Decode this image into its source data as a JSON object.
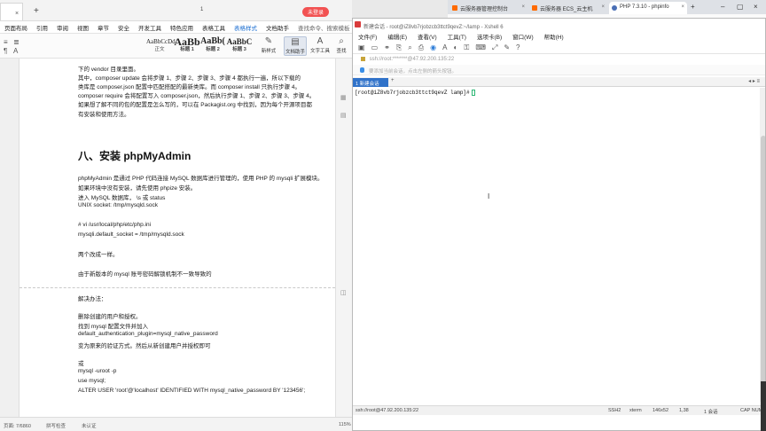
{
  "word": {
    "tab_close": "×",
    "tab_add": "+",
    "page_indicator": "1",
    "login_badge": "未登录",
    "menu": [
      "页面布局",
      "引用",
      "审阅",
      "视图",
      "章节",
      "安全",
      "开发工具",
      "特色应用",
      "表格工具",
      "表格样式",
      "文档助手",
      "查找命令、搜索模板"
    ],
    "menu_active_index": 9,
    "styles": [
      {
        "sample": "AaBbCcDd",
        "name": "正文"
      },
      {
        "sample": "AaBb",
        "name": "标题 1"
      },
      {
        "sample": "AaBb(",
        "name": "标题 2"
      },
      {
        "sample": "AaBbC",
        "name": "标题 3"
      }
    ],
    "ribbon_buttons": [
      {
        "icon": "✎",
        "label": "新样式"
      },
      {
        "icon": "▤",
        "label": "文档助手"
      },
      {
        "icon": "A",
        "label": "文字工具"
      },
      {
        "icon": "⌕",
        "label": "查找"
      }
    ],
    "lines": [
      {
        "t": "下的 vendor 目录里面。"
      },
      {
        "t": "    其中，composer update 会将步骤 1、步骤 2、步骤 3、步骤 4 都执行一遍，所以下载的"
      },
      {
        "t": "类库是 composer.json 配置中匹配搭配的最新类库。而 composer install 只执行步骤 4。"
      },
      {
        "t": "composer require 会将配置写入 composer.json，然后执行步骤 1、步骤 2、步骤 3、步骤 4。"
      },
      {
        "t": "如果想了解不同的包的配置是怎么写的，可以在 Packagist.org 中找到，因为每个开源项目都"
      },
      {
        "t": "有安装和使用方法。"
      }
    ],
    "heading": "八、安装 phpMyAdmin",
    "lines2": [
      {
        "t": "phpMyAdmin 是通过 PHP 代码连接 MySQL 数据库进行管理的，使用 PHP 的 mysqli 扩展模块。"
      },
      {
        "t": "如果环境中没有安装，请先使用 phpize 安装。"
      },
      {
        "t": "进入 MySQL 数据库，   \\s  或  status"
      },
      {
        "t": "UNIX socket:          /tmp/mysqld.sock"
      },
      {
        "t": ""
      },
      {
        "t": "# vi /usr/local/php/etc/php.ini"
      },
      {
        "t": "mysqli.default_socket = /tmp/mysqld.sock"
      },
      {
        "t": ""
      },
      {
        "t": "两个改成一样。"
      },
      {
        "t": ""
      },
      {
        "t": "由于新版本的 mysql 账号密码解锁机制不一致导致的"
      }
    ],
    "lines3": [
      {
        "t": "解决办法："
      },
      {
        "t": ""
      },
      {
        "t": "删除创建的用户和授权。"
      },
      {
        "t": "找到 mysql 配置文件并加入"
      },
      {
        "t": "default_authentication_plugin=mysql_native_password"
      },
      {
        "t": "变为原来的验证方式。然后从新创建用户并授权即可"
      },
      {
        "t": ""
      },
      {
        "t": "或"
      },
      {
        "t": "mysql -uroot -p"
      },
      {
        "t": "use mysql;"
      },
      {
        "t": "ALTER USER 'root'@'localhost' IDENTIFIED WITH mysql_native_password BY '123456';"
      }
    ],
    "status": {
      "page": "页面: 7/6860",
      "spell": "拼写检查",
      "auth": "未认证",
      "zoom": "115%"
    }
  },
  "browser": {
    "tabs": [
      {
        "label": "云服务器管理控制台",
        "color": "#ff6a00"
      },
      {
        "label": "云服务器 ECS_云主机",
        "color": "#ff6a00"
      },
      {
        "label": "PHP 7.3.10 - phpinfo",
        "color": "#4a6fb5"
      }
    ]
  },
  "xshell": {
    "title": "新建会话 - root@iZ8vb7rjobzcb3ttct9qevZ:~/lamp - Xshell 6",
    "menu": [
      "文件(F)",
      "编辑(E)",
      "查看(V)",
      "工具(T)",
      "选项卡(B)",
      "窗口(W)",
      "帮助(H)"
    ],
    "toolbar_icons": [
      "new-session-icon",
      "open-folder-icon",
      "link-icon",
      "copy-icon",
      "find-icon",
      "print-icon",
      "globe-icon",
      "font-icon",
      "color-icon",
      "lock-icon",
      "keyboard-icon",
      "fullscreen-icon",
      "script-icon",
      "help-icon"
    ],
    "toolbar_glyphs": [
      "▣",
      "▭",
      "⚭",
      "⎘",
      "⌕",
      "⎙",
      "◉",
      "A",
      "◐",
      "⚿",
      "⌨",
      "⤢",
      "✎",
      "?"
    ],
    "address": "ssh://root:*******@47.92.200.135:22",
    "tip": "要添加当前会话，点击左侧的箭头按钮。",
    "tab_label": "1 新建会话",
    "tab_add": "+",
    "tab_nav": "◂ ▸ ≡",
    "prompt": "[root@iZ8vb7rjobzcb3ttct9qevZ lamp]#",
    "status": {
      "connection": "ssh://root@47.92.200.135:22",
      "protocol": "SSH2",
      "term": "xterm",
      "size": "146x52",
      "pos": "1,38",
      "sessions": "1 会话",
      "caps": "CAP  NUM"
    }
  }
}
